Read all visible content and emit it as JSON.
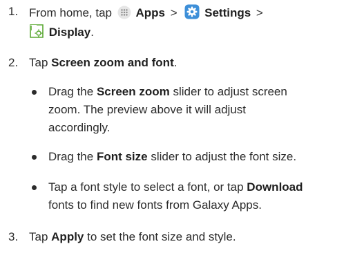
{
  "step1": {
    "number": "1.",
    "intro": "From home, tap",
    "apps_icon": "apps-grid-icon",
    "apps_label": "Apps",
    "separator1": ">",
    "settings_icon": "settings-gear-icon",
    "settings_label": "Settings",
    "separator2": ">",
    "display_icon": "display-icon",
    "display_label": "Display",
    "end": "."
  },
  "step2": {
    "number": "2.",
    "text_prefix": "Tap",
    "bold": "Screen zoom and font",
    "end": "."
  },
  "bullets": [
    {
      "l1_prefix": "Drag the",
      "l1_bold": "Screen zoom",
      "l1_suffix": "slider to adjust screen",
      "l2": "zoom. The preview above it will adjust",
      "l3": "accordingly."
    },
    {
      "l1_prefix": "Drag the",
      "l1_bold": "Font size",
      "l1_suffix": "slider to adjust the font size."
    },
    {
      "l1_prefix": "Tap a font style to select a font, or tap",
      "l1_bold": "Download",
      "l2": "fonts to find new fonts from Galaxy Apps."
    }
  ],
  "step3": {
    "number": "3.",
    "text_prefix": "Tap",
    "bold": "Apply",
    "text_suffix": "to set the font size and style."
  },
  "colors": {
    "text": "#2b2b2b",
    "settings_icon_bg": "#3d8fd8",
    "display_icon_green": "#5aa832",
    "apps_icon_bg": "#e6e6e6"
  }
}
